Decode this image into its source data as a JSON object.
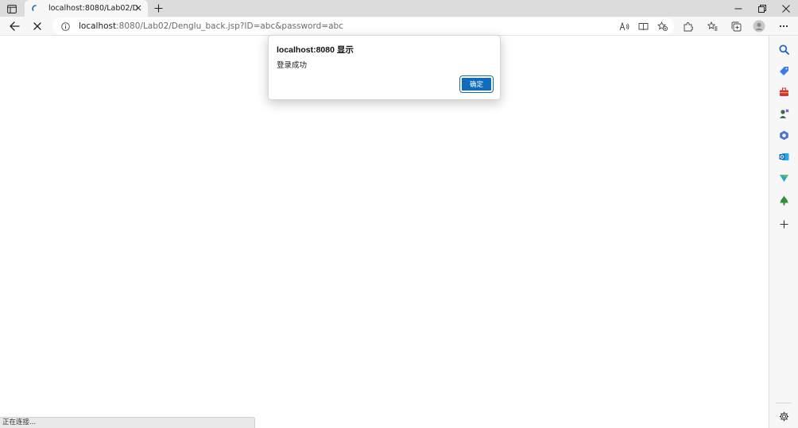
{
  "tab": {
    "title": "localhost:8080/Lab02/Denglu_back.jsp?ID=abc&password=abc",
    "favicon": "loading-spinner-icon"
  },
  "toolbar": {
    "back_icon": "back-arrow-icon",
    "stop_icon": "stop-loading-icon",
    "url_host": "localhost",
    "url_rest": ":8080/Lab02/Denglu_back.jsp?ID=abc&password=abc"
  },
  "dialog": {
    "title": "localhost:8080 显示",
    "message": "登录成功",
    "ok_label": "确定"
  },
  "status": {
    "text": "正在连接..."
  },
  "sidebar": {
    "items": [
      "search-icon",
      "shopping-tag-icon",
      "tools-icon",
      "games-icon",
      "office-icon",
      "outlook-icon",
      "drop-icon",
      "tree-icon",
      "add-icon"
    ],
    "settings_icon": "gear-icon"
  },
  "colors": {
    "accent": "#0f6cbd",
    "tabstrip": "#dcdcdc",
    "toolbar": "#f7f7f7"
  }
}
